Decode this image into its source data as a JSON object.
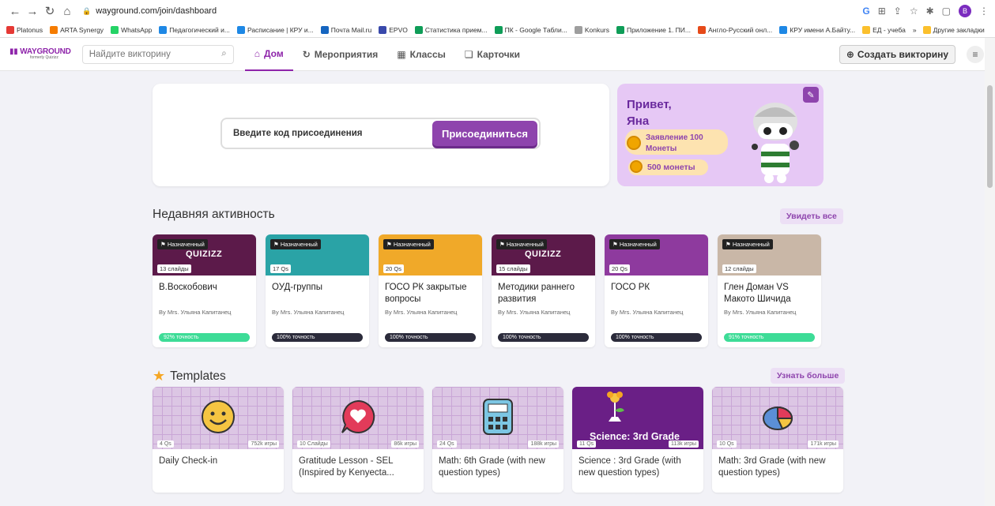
{
  "browser": {
    "url": "wayground.com/join/dashboard",
    "bookmarks": [
      {
        "label": "Platonus",
        "color": "#e53935"
      },
      {
        "label": "ARTA Synergy",
        "color": "#f57c00"
      },
      {
        "label": "WhatsApp",
        "color": "#25d366"
      },
      {
        "label": "Педагогический и...",
        "color": "#1e88e5"
      },
      {
        "label": "Расписание | КРУ и...",
        "color": "#1e88e5"
      },
      {
        "label": "Почта Mail.ru",
        "color": "#1565c0"
      },
      {
        "label": "EPVO",
        "color": "#3949ab"
      },
      {
        "label": "Статистика прием...",
        "color": "#0f9d58"
      },
      {
        "label": "ПК - Google Табли...",
        "color": "#0f9d58"
      },
      {
        "label": "Konkurs",
        "color": "#9e9e9e"
      },
      {
        "label": "Приложение 1. ПИ...",
        "color": "#0f9d58"
      },
      {
        "label": "Англо-Русский онл...",
        "color": "#e64a19"
      },
      {
        "label": "КРУ имени А.Байту...",
        "color": "#1e88e5"
      },
      {
        "label": "ЕД - учеба",
        "color": "#fbc02d"
      }
    ],
    "more_label": "»",
    "other_bookmarks": "Другие закладки",
    "profile_initial": "В"
  },
  "header": {
    "logo_main": "WAYGROUND",
    "logo_sub": "formerly Quizizz",
    "search_placeholder": "Найдите викторину",
    "tabs": [
      {
        "icon": "⌂",
        "label": "Дом"
      },
      {
        "icon": "↻",
        "label": "Мероприятия"
      },
      {
        "icon": "▦",
        "label": "Классы"
      },
      {
        "icon": "❏",
        "label": "Карточки"
      }
    ],
    "create_label": "Создать викторину"
  },
  "join": {
    "placeholder": "Введите код присоединения",
    "button": "Присоединиться"
  },
  "greeting": {
    "line1": "Привет,",
    "line2": "Яна",
    "pill1": "Заявление 100 Монеты",
    "pill2": "500 монеты"
  },
  "recent": {
    "title": "Недавняя активность",
    "see_all": "Увидеть все",
    "tag": "Назначенный",
    "cards": [
      {
        "bg": "#5c1a4a",
        "logo": "QUIZIZZ",
        "count": "13 слайды",
        "title": "В.Воскобович",
        "by": "By Mrs. Ульяна Капитанец",
        "accuracy": "92% точность",
        "acc_color": "#3ddc97"
      },
      {
        "bg": "#2aa3a6",
        "logo": "",
        "count": "17 Qs",
        "title": "ОУД-группы",
        "by": "By Mrs. Ульяна Капитанец",
        "accuracy": "100% точность",
        "acc_color": "#2b2b3b"
      },
      {
        "bg": "#f0a929",
        "logo": "",
        "count": "20 Qs",
        "title": "ГОСО РК закрытые вопросы",
        "by": "By Mrs. Ульяна Капитанец",
        "accuracy": "100% точность",
        "acc_color": "#2b2b3b"
      },
      {
        "bg": "#5c1a4a",
        "logo": "QUIZIZZ",
        "count": "15 слайды",
        "title": "Методики раннего развития",
        "by": "By Mrs. Ульяна Капитанец",
        "accuracy": "100% точность",
        "acc_color": "#2b2b3b"
      },
      {
        "bg": "#8e3a9e",
        "logo": "",
        "count": "20 Qs",
        "title": "ГОСО РК",
        "by": "By Mrs. Ульяна Капитанец",
        "accuracy": "100% точность",
        "acc_color": "#2b2b3b"
      },
      {
        "bg": "#c9b7a7",
        "logo": "",
        "count": "12 слайды",
        "title": "Глен Доман VS Макото Шичида",
        "by": "By Mrs. Ульяна Капитанец",
        "accuracy": "91% точность",
        "acc_color": "#3ddc97"
      }
    ]
  },
  "templates": {
    "title": "Templates",
    "see_more": "Узнать больше",
    "cards": [
      {
        "icon": "smiley-icon",
        "qs": "4 Qs",
        "plays": "752k игры",
        "title": "Daily Check-in"
      },
      {
        "icon": "heart-bubble-icon",
        "qs": "10 Слайды",
        "plays": "86k игры",
        "title": "Gratitude Lesson - SEL (Inspired by Kenyecta..."
      },
      {
        "icon": "calculator-icon",
        "qs": "24 Qs",
        "plays": "188k игры",
        "title": "Math: 6th Grade (with new question types)"
      },
      {
        "icon": "plant-icon",
        "qs": "11 Qs",
        "plays": "113k игры",
        "title": "Science : 3rd Grade (with new question types)",
        "banner": "Science: 3rd Grade"
      },
      {
        "icon": "pie-chart-icon",
        "qs": "10 Qs",
        "plays": "171k игры",
        "title": "Math: 3rd Grade (with new question types)"
      }
    ]
  }
}
